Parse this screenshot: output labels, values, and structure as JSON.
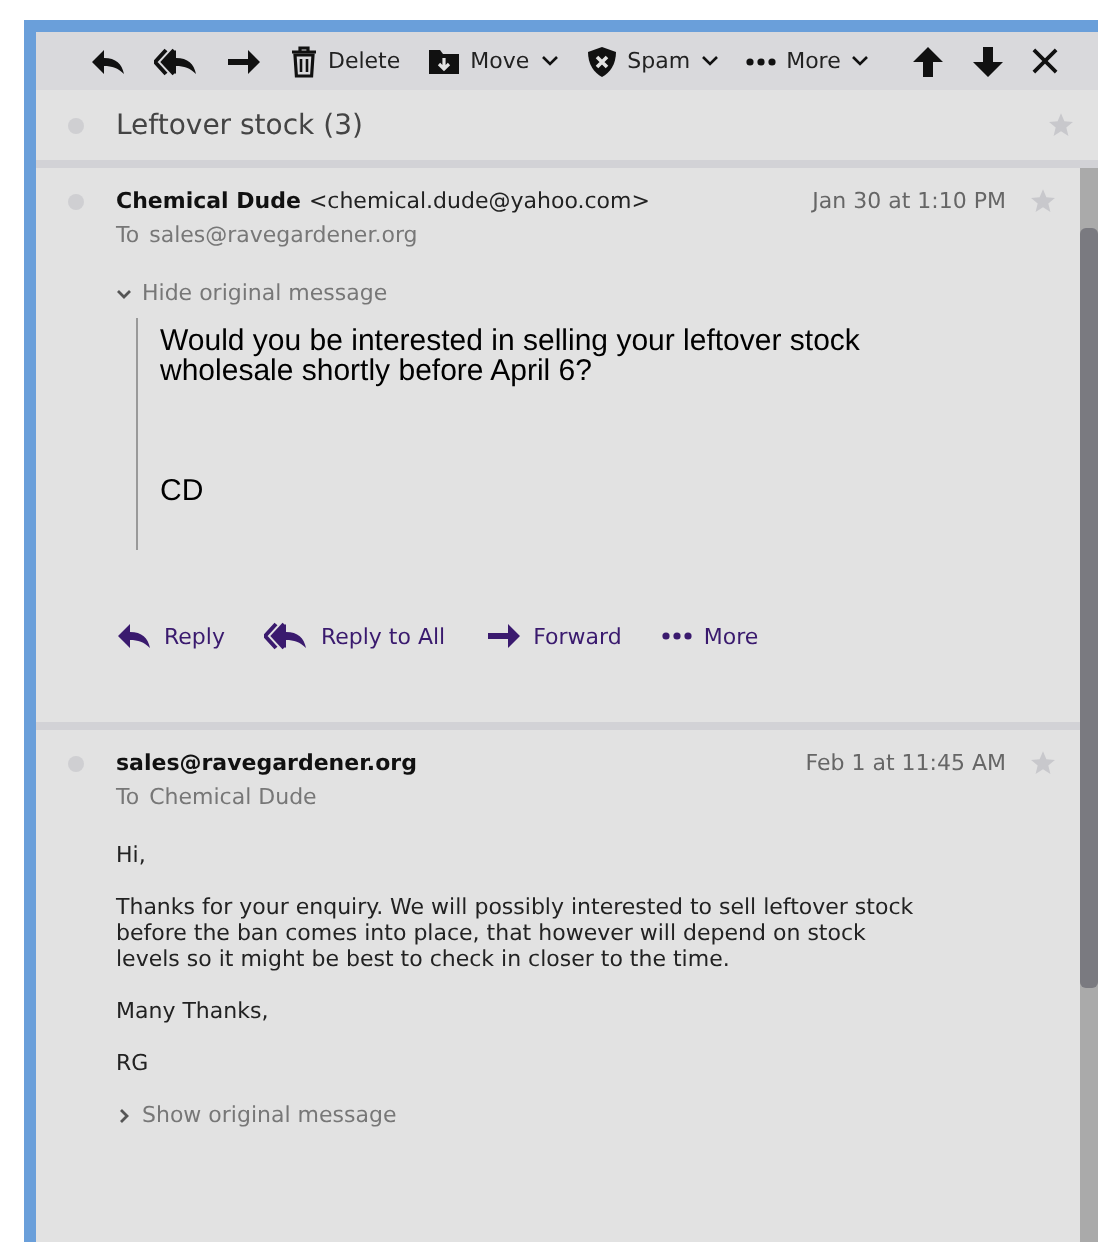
{
  "toolbar": [
    {
      "kind": "reply"
    },
    {
      "kind": "reply-all"
    },
    {
      "kind": "forward"
    },
    {
      "kind": "delete",
      "label": "Delete"
    },
    {
      "kind": "move",
      "label": "Move",
      "dropdown": true
    },
    {
      "kind": "spam",
      "label": "Spam",
      "dropdown": true
    },
    {
      "kind": "more",
      "label": "More",
      "dropdown": true
    },
    {
      "kind": "up"
    },
    {
      "kind": "down"
    },
    {
      "kind": "close"
    }
  ],
  "thread": {
    "subject": "Leftover stock (3)",
    "starred": false
  },
  "messages": [
    {
      "sender_name": "Chemical Dude",
      "sender_email": "<chemical.dude@yahoo.com>",
      "to_label": "To",
      "recipient": "sales@ravegardener.org",
      "date": "Jan 30 at 1:10 PM",
      "starred": false,
      "original": {
        "toggle": "Hide original message",
        "expanded": true,
        "paragraphs": [
          "Would you be interested in selling your leftover stock wholesale shortly before April 6?",
          "CD"
        ]
      },
      "actions": [
        {
          "kind": "reply",
          "label": "Reply"
        },
        {
          "kind": "reply-all",
          "label": "Reply to All"
        },
        {
          "kind": "forward",
          "label": "Forward"
        },
        {
          "kind": "more",
          "label": "More"
        }
      ]
    },
    {
      "sender_name": "sales@ravegardener.org",
      "to_label": "To",
      "recipient": "Chemical Dude",
      "date": "Feb 1 at 11:45 AM",
      "starred": false,
      "body": [
        "Hi,",
        "Thanks for your enquiry. We will possibly interested to sell leftover stock before the ban comes into place, that however will depend on stock levels so it might be best to check in closer to the time.",
        "Many Thanks,",
        "RG"
      ],
      "original": {
        "toggle": "Show original message",
        "expanded": false
      }
    }
  ]
}
